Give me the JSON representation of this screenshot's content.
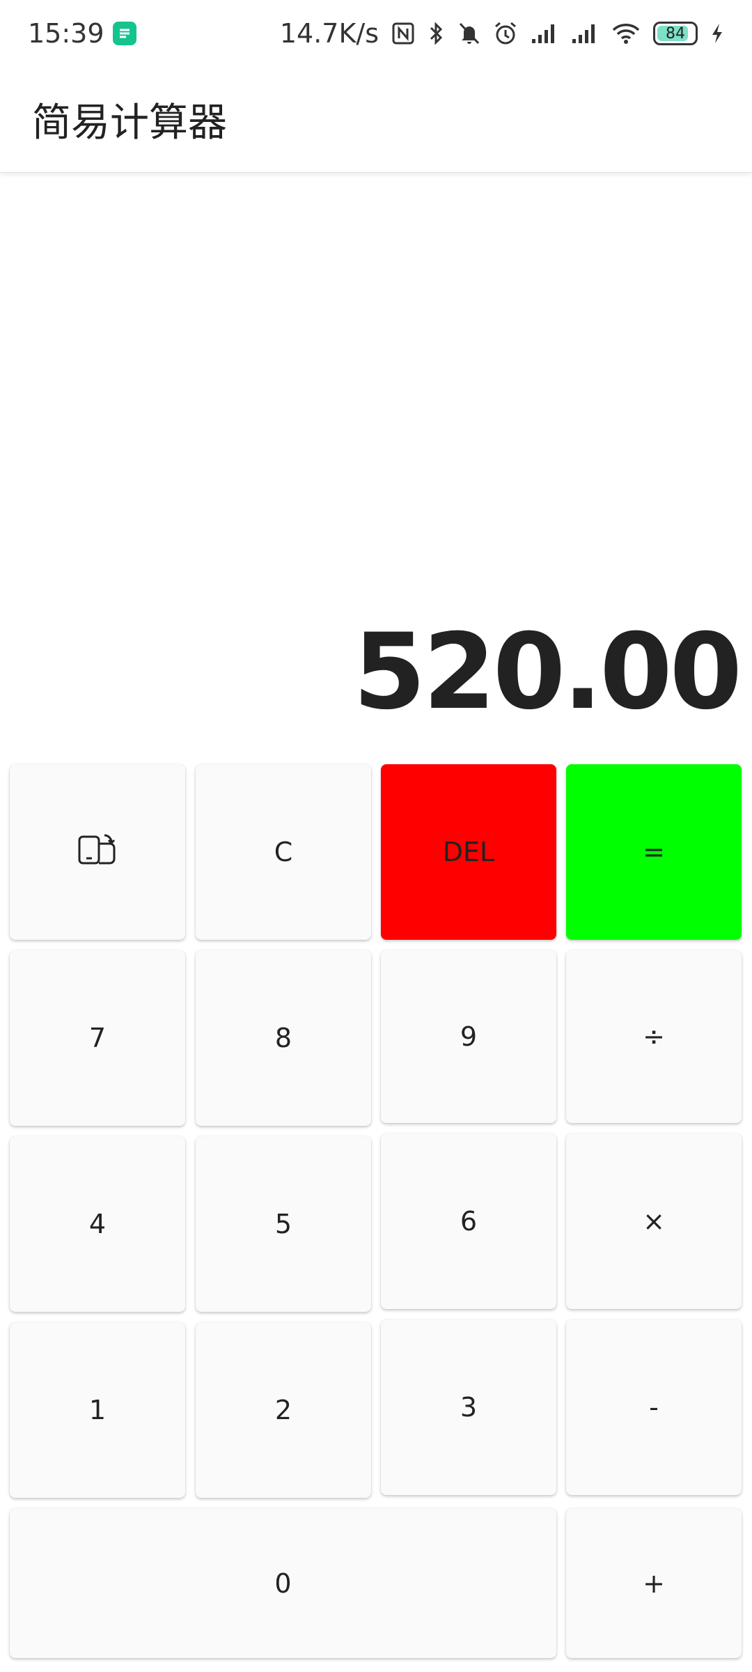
{
  "status_bar": {
    "time": "15:39",
    "network_speed": "14.7K/s",
    "battery_level": "84",
    "icons": [
      "app-notification-icon",
      "nfc-icon",
      "bluetooth-icon",
      "mute-icon",
      "alarm-icon",
      "signal-icon",
      "signal-icon",
      "wifi-icon",
      "battery-icon",
      "charging-icon"
    ]
  },
  "app_bar": {
    "title": "简易计算器"
  },
  "display": {
    "value": "520.00"
  },
  "keys": {
    "rotate": "rotate-screen-icon",
    "clear": "C",
    "delete": "DEL",
    "equals": "=",
    "seven": "7",
    "eight": "8",
    "nine": "9",
    "divide": "÷",
    "four": "4",
    "five": "5",
    "six": "6",
    "multiply": "×",
    "one": "1",
    "two": "2",
    "three": "3",
    "minus": "-",
    "zero": "0",
    "plus": "+"
  },
  "colors": {
    "delete_bg": "#ff0000",
    "equals_bg": "#00ff00",
    "key_bg": "#fafafa"
  }
}
